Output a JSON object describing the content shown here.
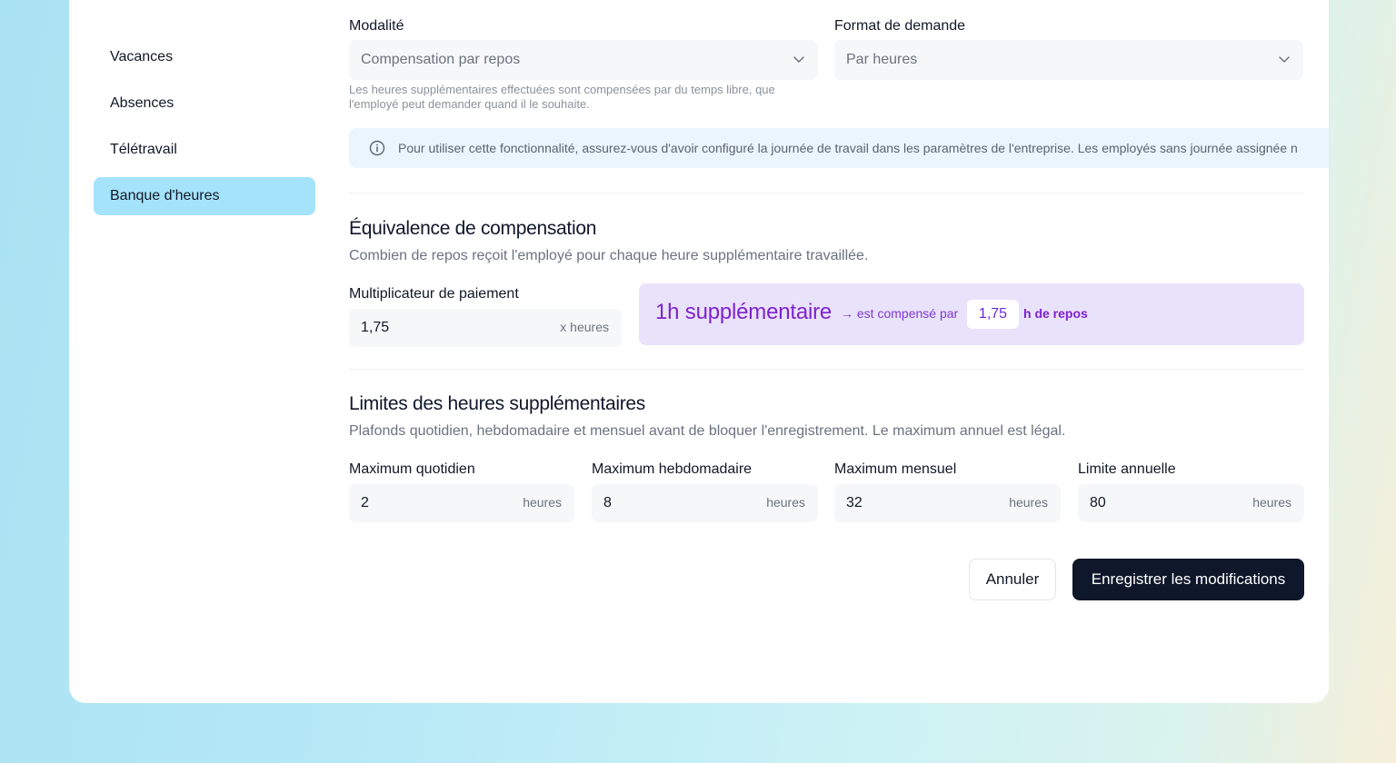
{
  "sidebar": {
    "items": [
      {
        "label": "Vacances",
        "active": false
      },
      {
        "label": "Absences",
        "active": false
      },
      {
        "label": "Télétravail",
        "active": false
      },
      {
        "label": "Banque d'heures",
        "active": true
      }
    ]
  },
  "modality": {
    "label": "Modalité",
    "value": "Compensation par repos",
    "help": "Les heures supplémentaires effectuées sont compensées par du temps libre, que l'employé peut demander quand il le souhaite."
  },
  "request_format": {
    "label": "Format de demande",
    "value": "Par heures"
  },
  "info_banner": {
    "text": "Pour utiliser cette fonctionnalité, assurez-vous d'avoir configuré la journée de travail dans les paramètres de l'entreprise. Les employés sans journée assignée n"
  },
  "compensation": {
    "title": "Équivalence de compensation",
    "subtitle": "Combien de repos reçoit l'employé pour chaque heure supplémentaire travaillée.",
    "multiplier_label": "Multiplicateur de paiement",
    "multiplier_value": "1,75",
    "multiplier_unit": "x heures",
    "summary_big": "1h supplémentaire",
    "summary_arrow": "→ est compensé par",
    "summary_value": "1,75",
    "summary_unit": "h de repos"
  },
  "limits": {
    "title": "Limites des heures supplémentaires",
    "subtitle": "Plafonds quotidien, hebdomadaire et mensuel avant de bloquer l'enregistrement. Le maximum annuel est légal.",
    "fields": [
      {
        "label": "Maximum quotidien",
        "value": "2",
        "unit": "heures"
      },
      {
        "label": "Maximum hebdomadaire",
        "value": "8",
        "unit": "heures"
      },
      {
        "label": "Maximum mensuel",
        "value": "32",
        "unit": "heures"
      },
      {
        "label": "Limite annuelle",
        "value": "80",
        "unit": "heures"
      }
    ]
  },
  "actions": {
    "cancel": "Annuler",
    "save": "Enregistrer les modifications"
  },
  "colors": {
    "accent_active": "#a5e3fb",
    "primary_button": "#0f172a",
    "summary_bg": "#e9e2fb",
    "summary_text": "#7e22ce"
  }
}
